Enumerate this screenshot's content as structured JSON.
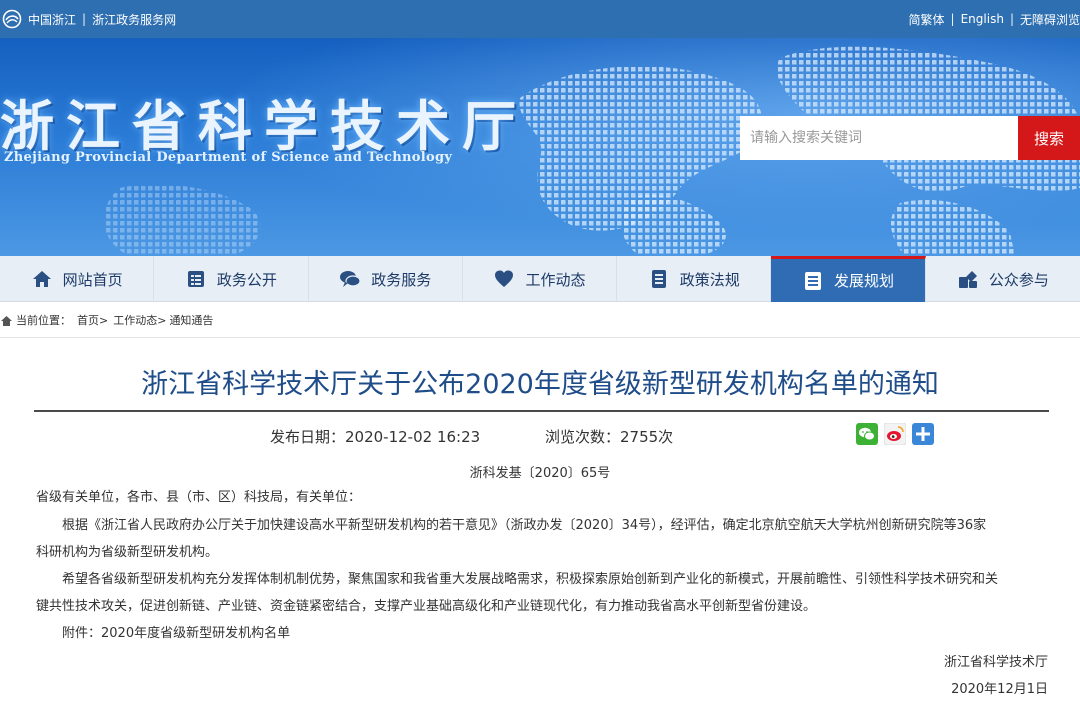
{
  "topbar": {
    "logo_icon": "gov-emblem-icon",
    "link1": "中国浙江",
    "separator": "|",
    "link2": "浙江政务服务网",
    "lang_simplified": "简繁体",
    "lang_english": "English",
    "accessibility": "无障碍浏览"
  },
  "banner": {
    "title": "浙江省科学技术厅",
    "subtitle": "Zhejiang Provincial Department of Science and Technology",
    "search_placeholder": "请输入搜索关键词",
    "search_button": "搜索",
    "accent_color": "#d4181a"
  },
  "nav": {
    "items": [
      {
        "label": "网站首页",
        "icon": "home-icon"
      },
      {
        "label": "政务公开",
        "icon": "document-list-icon"
      },
      {
        "label": "政务服务",
        "icon": "chat-bubble-icon"
      },
      {
        "label": "工作动态",
        "icon": "heart-icon"
      },
      {
        "label": "政策法规",
        "icon": "list-doc-icon"
      },
      {
        "label": "发展规划",
        "icon": "plan-icon",
        "active": true
      },
      {
        "label": "公众参与",
        "icon": "share-participate-icon"
      }
    ]
  },
  "breadcrumb": {
    "prefix": "当前位置：",
    "items": [
      "首页>",
      "工作动态>",
      "通知通告"
    ]
  },
  "article": {
    "title": "浙江省科学技术厅关于公布2020年度省级新型研发机构名单的通知",
    "publish_date": "发布日期：2020-12-02 16:23",
    "view_count": "浏览次数：2755次",
    "doc_number": "浙科发基〔2020〕65号",
    "paragraphs": [
      "省级有关单位，各市、县（市、区）科技局，有关单位：",
      "根据《浙江省人民政府办公厅关于加快建设高水平新型研发机构的若干意见》（浙政办发〔2020〕34号），经评估，确定北京航空航天大学杭州创新研究院等36家",
      "科研机构为省级新型研发机构。",
      "希望各省级新型研发机构充分发挥体制机制优势，聚焦国家和我省重大发展战略需求，积极探索原始创新到产业化的新模式，开展前瞻性、引领性科学技术研究和关",
      "键共性技术攻关，促进创新链、产业链、资金链紧密结合，支撑产业基础高级化和产业链现代化，有力推动我省高水平创新型省份建设。",
      "附件：2020年度省级新型研发机构名单"
    ],
    "signer": "浙江省科学技术厅",
    "sign_date": "2020年12月1日"
  },
  "share": [
    {
      "icon": "wechat-icon",
      "color": "#3db135"
    },
    {
      "icon": "weibo-icon",
      "color": "#e6162d"
    },
    {
      "icon": "plus-share-icon",
      "color": "#3a86d9"
    }
  ]
}
